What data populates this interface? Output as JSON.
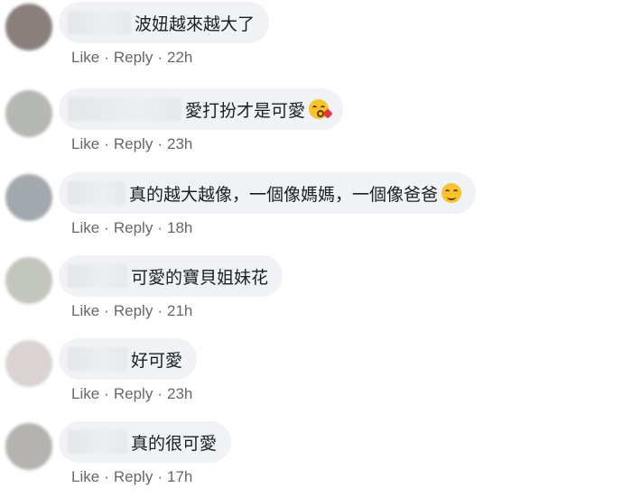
{
  "comments": [
    {
      "text": "波妞越來越大了",
      "emoji": "",
      "like": "Like",
      "reply": "Reply",
      "time": "22h",
      "avatar_color": "#8a7f7d",
      "name_width": 70
    },
    {
      "text": "愛打扮才是可愛",
      "emoji": "face-blowing-kiss",
      "like": "Like",
      "reply": "Reply",
      "time": "23h",
      "avatar_color": "#b5b8b2",
      "name_width": 126
    },
    {
      "text": "真的越大越像，一個像媽媽，一個像爸爸",
      "emoji": "smiling-face",
      "like": "Like",
      "reply": "Reply",
      "time": "18h",
      "avatar_color": "#a3a8ae",
      "name_width": 64
    },
    {
      "text": "可愛的寶貝姐妹花",
      "emoji": "",
      "like": "Like",
      "reply": "Reply",
      "time": "21h",
      "avatar_color": "#c3c6bd",
      "name_width": 66
    },
    {
      "text": "好可愛",
      "emoji": "",
      "like": "Like",
      "reply": "Reply",
      "time": "23h",
      "avatar_color": "#d9d3d2",
      "name_width": 66
    },
    {
      "text": "真的很可愛",
      "emoji": "",
      "like": "Like",
      "reply": "Reply",
      "time": "17h",
      "avatar_color": "#b4b3b0",
      "name_width": 66
    }
  ],
  "separator": "·"
}
